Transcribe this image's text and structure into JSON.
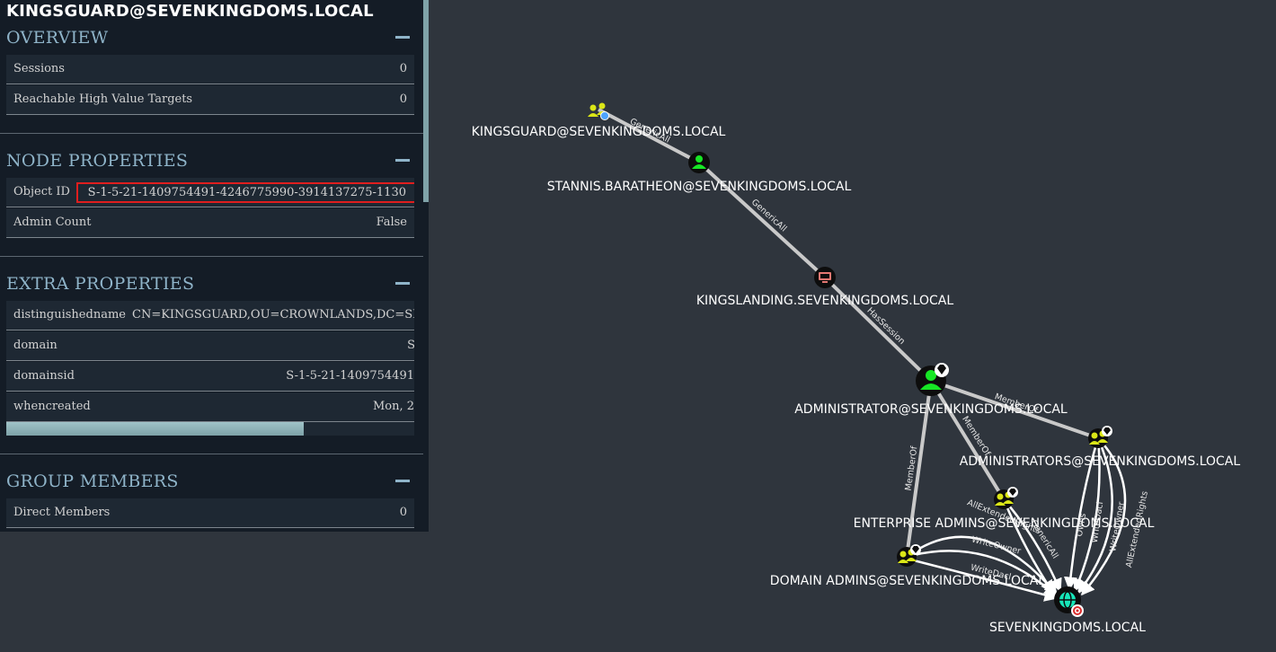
{
  "graph": {
    "nodes": {
      "kingsguard": "KINGSGUARD@SEVENKINGDOMS.LOCAL",
      "stannis": "STANNIS.BARATHEON@SEVENKINGDOMS.LOCAL",
      "kingslanding": "KINGSLANDING.SEVENKINGDOMS.LOCAL",
      "administrator": "ADMINISTRATOR@SEVENKINGDOMS.LOCAL",
      "administrators": "ADMINISTRATORS@SEVENKINGDOMS.LOCAL",
      "enterprise_admins": "ENTERPRISE ADMINS@SEVENKINGDOMS.LOCAL",
      "domain_admins": "DOMAIN ADMINS@SEVENKINGDOMS.LOCAL",
      "domain": "SEVENKINGDOMS.LOCAL"
    },
    "edges": {
      "kingsguard_stannis": "GenericAll",
      "stannis_kingslanding": "GenericAll",
      "kingslanding_administrator": "HasSession",
      "admin_to_administrators": "MemberOf",
      "admin_to_enterprise": "MemberOf",
      "admin_to_domainadmins": "MemberOf",
      "ea_1": "AllExtendedRights",
      "ea_2": "GenericAll",
      "da_1": "WriteOwner",
      "da_2": "WriteDacl",
      "adm_1": "Owns",
      "adm_2": "WriteDacl",
      "adm_3": "WriteOwner",
      "adm_4": "AllExtendedRights"
    },
    "colors": {
      "user": "#17e625",
      "group": "#dbe617",
      "computer": "#e67873",
      "domain": "#17e6b9",
      "edge": "#c9c9c9"
    }
  },
  "panel": {
    "title": "KINGSGUARD@SEVENKINGDOMS.LOCAL",
    "overview": {
      "header": "OVERVIEW",
      "rows": [
        {
          "key": "Sessions",
          "value": "0"
        },
        {
          "key": "Reachable High Value Targets",
          "value": "0"
        }
      ]
    },
    "node_properties": {
      "header": "NODE PROPERTIES",
      "rows": [
        {
          "key": "Object ID",
          "value": "S-1-5-21-1409754491-4246775990-3914137275-1130"
        },
        {
          "key": "Admin Count",
          "value": "False"
        }
      ]
    },
    "extra_properties": {
      "header": "EXTRA PROPERTIES",
      "rows": [
        {
          "key": "distinguishedname",
          "value": "CN=KINGSGUARD,OU=CROWNLANDS,DC=SEVE"
        },
        {
          "key": "domain",
          "value": "S"
        },
        {
          "key": "domainsid",
          "value": "S-1-5-21-1409754491"
        },
        {
          "key": "whencreated",
          "value": "Mon, 2"
        }
      ]
    },
    "group_members": {
      "header": "GROUP MEMBERS",
      "rows": [
        {
          "key": "Direct Members",
          "value": "0"
        }
      ]
    }
  }
}
